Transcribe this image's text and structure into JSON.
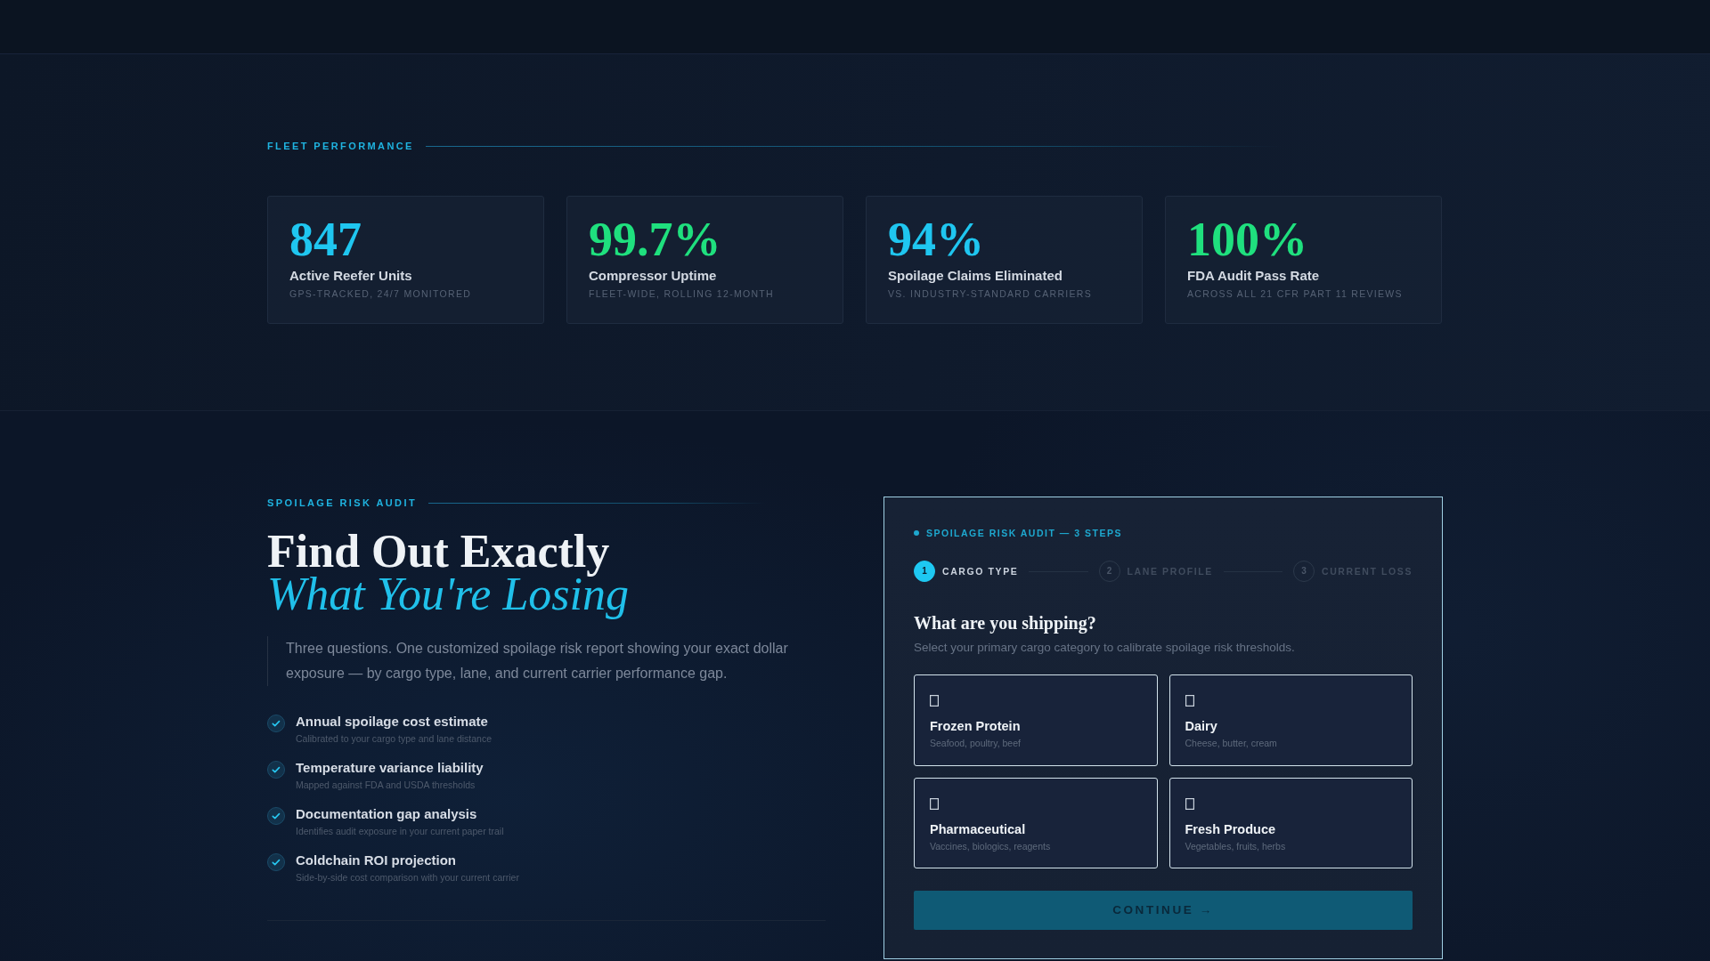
{
  "fleet_performance": {
    "eyebrow": "FLEET PERFORMANCE",
    "stats": [
      {
        "value": "847",
        "label": "Active Reefer Units",
        "note": "GPS-TRACKED, 24/7 MONITORED",
        "color": "#1fc6f0"
      },
      {
        "value": "99.7%",
        "label": "Compressor Uptime",
        "note": "FLEET-WIDE, ROLLING 12-MONTH",
        "color": "#1fe07e"
      },
      {
        "value": "94%",
        "label": "Spoilage Claims Eliminated",
        "note": "VS. INDUSTRY-STANDARD CARRIERS",
        "color": "#1fc6f0"
      },
      {
        "value": "100%",
        "label": "FDA Audit Pass Rate",
        "note": "ACROSS ALL 21 CFR PART 11 REVIEWS",
        "color": "#1fe07e"
      }
    ]
  },
  "spoilage_audit": {
    "eyebrow": "SPOILAGE RISK AUDIT",
    "heading": "Find Out Exactly",
    "heading_accent": "What You're Losing",
    "intro": "Three questions. One customized spoilage risk report showing your exact dollar exposure — by cargo type, lane, and current carrier performance gap.",
    "benefits": [
      {
        "title": "Annual spoilage cost estimate",
        "detail": "Calibrated to your cargo type and lane distance"
      },
      {
        "title": "Temperature variance liability",
        "detail": "Mapped against FDA and USDA thresholds"
      },
      {
        "title": "Documentation gap analysis",
        "detail": "Identifies audit exposure in your current paper trail"
      },
      {
        "title": "Coldchain ROI projection",
        "detail": "Side-by-side cost comparison with your current carrier"
      }
    ]
  },
  "audit_form": {
    "kicker": "SPOILAGE RISK AUDIT — 3 STEPS",
    "steps": [
      {
        "number": "1",
        "label": "CARGO TYPE",
        "active": true
      },
      {
        "number": "2",
        "label": "LANE PROFILE",
        "active": false
      },
      {
        "number": "3",
        "label": "CURRENT LOSS",
        "active": false
      }
    ],
    "question": "What are you shipping?",
    "hint": "Select your primary cargo category to calibrate spoilage risk thresholds.",
    "options": [
      {
        "title": "Frozen Protein",
        "examples": "Seafood, poultry, beef",
        "selected": false
      },
      {
        "title": "Dairy",
        "examples": "Cheese, butter, cream",
        "selected": false
      },
      {
        "title": "Pharmaceutical",
        "examples": "Vaccines, biologics, reagents",
        "selected": false
      },
      {
        "title": "Fresh Produce",
        "examples": "Vegetables, fruits, herbs",
        "selected": false
      }
    ],
    "continue_button": {
      "label": "CONTINUE →",
      "disabled": true
    }
  }
}
